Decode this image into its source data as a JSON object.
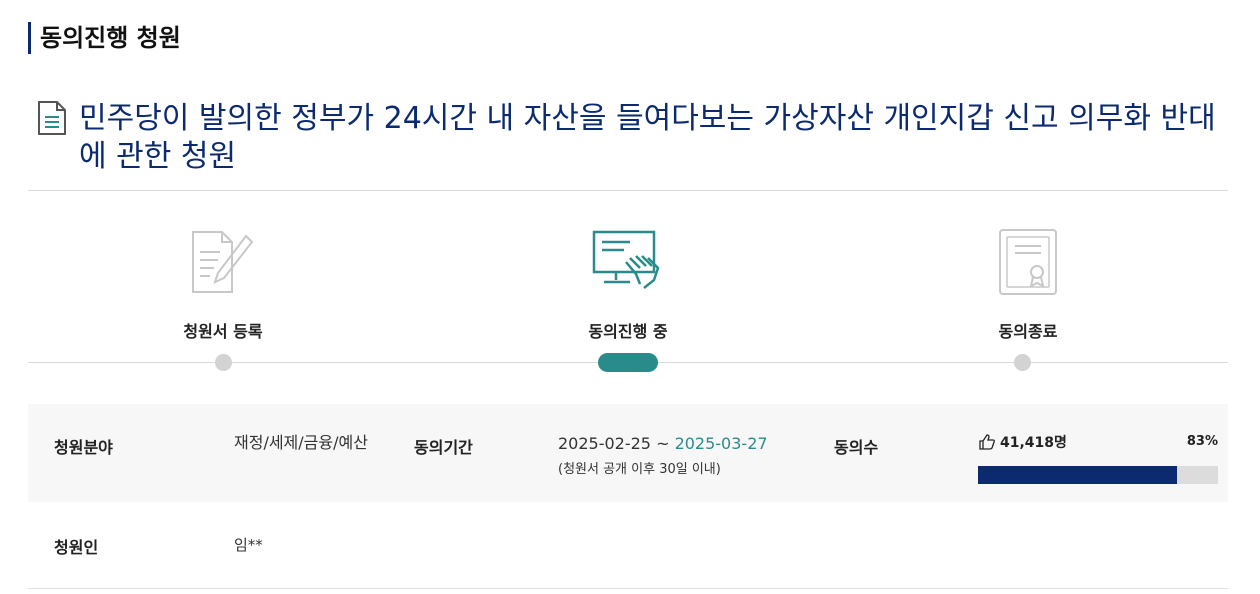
{
  "section_title": "동의진행 청원",
  "petition_title": "민주당이 발의한 정부가 24시간 내 자산을 들여다보는 가상자산 개인지갑 신고 의무화 반대에 관한 청원",
  "steps": [
    {
      "label": "청원서 등록",
      "icon": "write-document-icon",
      "active": false
    },
    {
      "label": "동의진행 중",
      "icon": "monitor-touch-icon",
      "active": true
    },
    {
      "label": "동의종료",
      "icon": "certificate-icon",
      "active": false
    }
  ],
  "info": {
    "field_label": "청원분야",
    "field_value": "재정/세제/금융/예산",
    "period_label": "동의기간",
    "period_start": "2025-02-25",
    "period_sep": " ~ ",
    "period_end": "2025-03-27",
    "period_note": "(청원서 공개 이후 30일 이내)",
    "count_label": "동의수",
    "count_value": "41,418명",
    "percent": "83%",
    "progress": 0.83,
    "petitioner_label": "청원인",
    "petitioner_value": "임**"
  },
  "colors": {
    "navy": "#0b2a6f",
    "teal": "#2a8c8a",
    "inactive": "#d3d3d3"
  }
}
